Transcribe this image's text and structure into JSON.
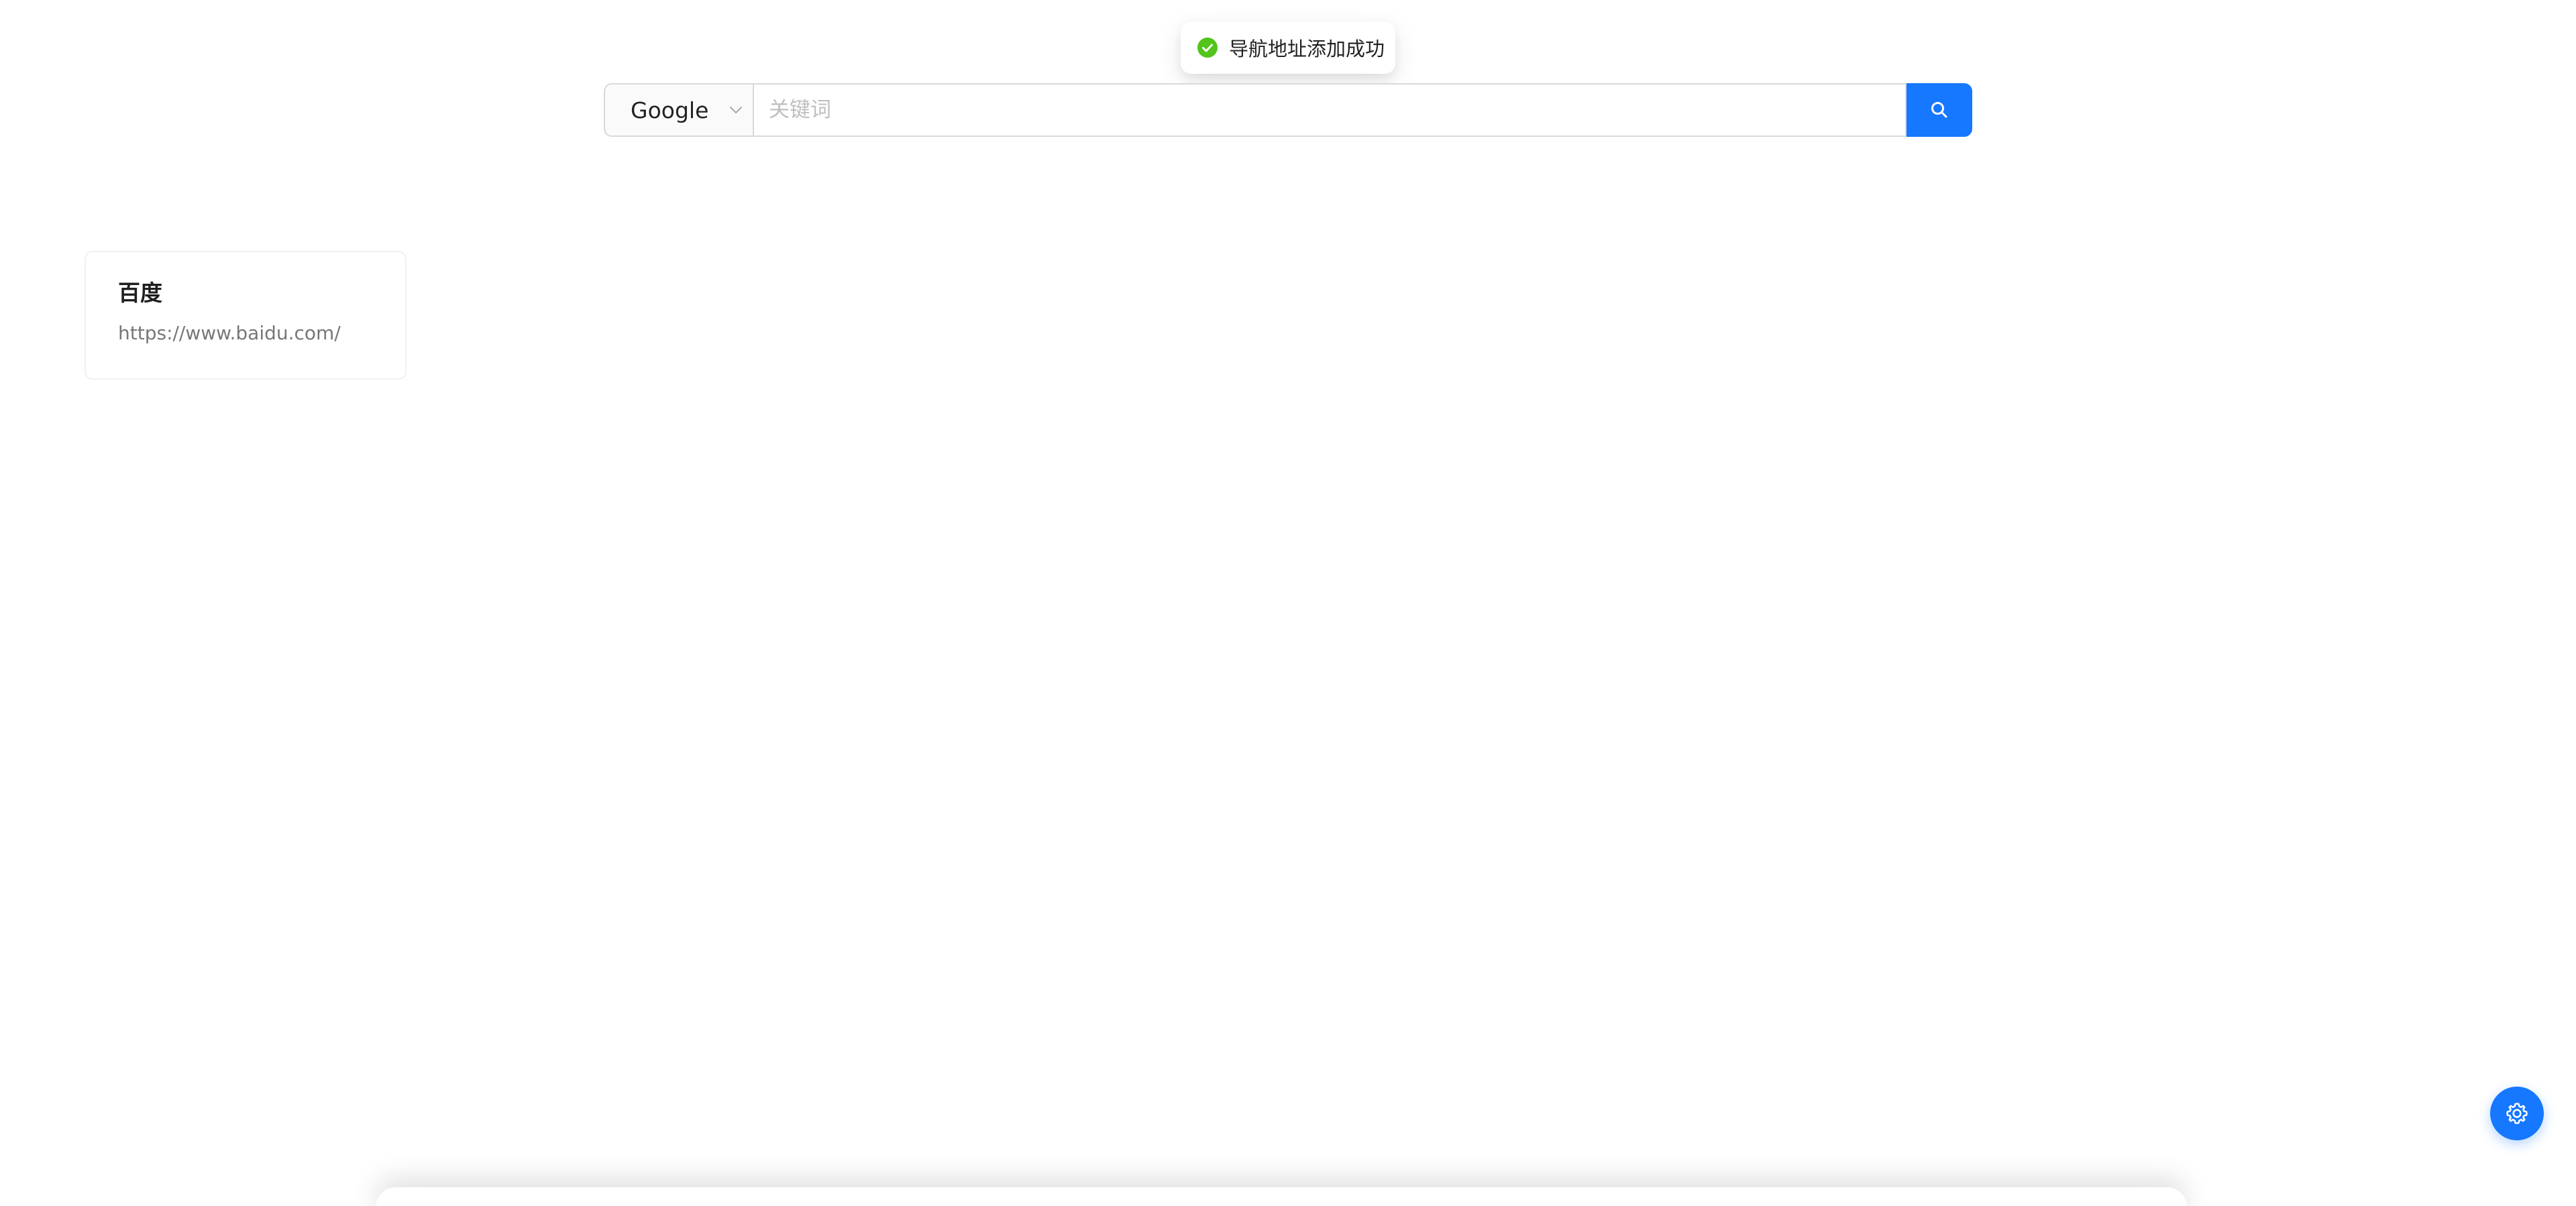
{
  "toast": {
    "message": "导航地址添加成功",
    "icon": "check-circle-icon",
    "color": "#52c41a"
  },
  "search": {
    "engine": "Google",
    "placeholder": "关键词",
    "value": "",
    "button_icon": "search-icon",
    "button_color": "#1677ff"
  },
  "nav_items": [
    {
      "title": "百度",
      "url": "https://www.baidu.com/"
    }
  ],
  "settings": {
    "icon": "gear-icon",
    "color": "#1677ff"
  }
}
